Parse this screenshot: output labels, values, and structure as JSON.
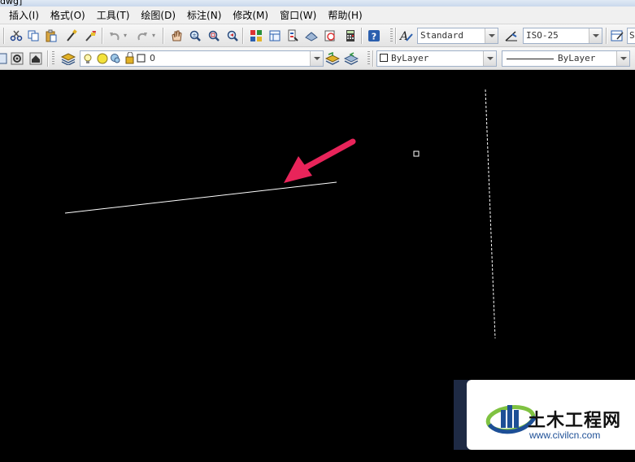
{
  "window": {
    "title_fragment": "dwg]"
  },
  "menu": [
    {
      "label": "插入(I)"
    },
    {
      "label": "格式(O)"
    },
    {
      "label": "工具(T)"
    },
    {
      "label": "绘图(D)"
    },
    {
      "label": "标注(N)"
    },
    {
      "label": "修改(M)"
    },
    {
      "label": "窗口(W)"
    },
    {
      "label": "帮助(H)"
    }
  ],
  "toolbar": {
    "text_style": "Standard",
    "dim_style": "ISO-25",
    "table_style_fragment": "S"
  },
  "layers": {
    "current_layer": "0",
    "color": "ByLayer",
    "linetype": "ByLayer"
  },
  "icons": {
    "cut": "cut-icon",
    "copy": "copy-icon",
    "paste": "paste-icon",
    "match_properties": "match-properties-icon",
    "undo": "undo-icon",
    "redo": "redo-icon",
    "pan": "pan-icon",
    "help": "help-icon"
  },
  "colors": {
    "canvas": "#000000",
    "annotation_arrow": "#e8245a",
    "drawn_line": "#ffffff"
  },
  "watermark": {
    "title": "土木工程网",
    "url": "www.civilcn.com"
  }
}
